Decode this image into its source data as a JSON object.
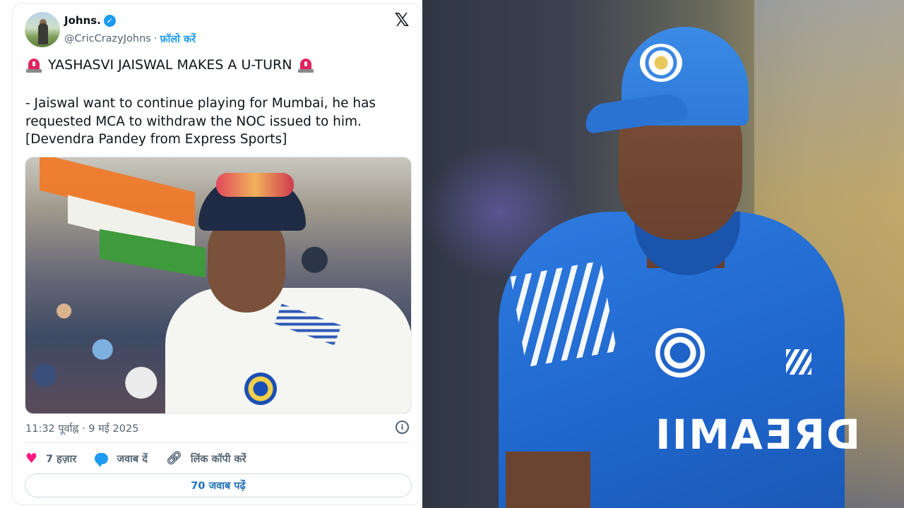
{
  "tweet": {
    "author": {
      "display_name": "Johns.",
      "handle": "@CricCrazyJohns",
      "separator": "·",
      "follow_label": "फ़ॉलो करें",
      "verified": true
    },
    "headline": "YASHASVI JAISWAL MAKES A U-TURN",
    "body": "- Jaiswal want to continue playing for Mumbai, he has requested MCA to withdraw the NOC issued to him.\n[Devendra Pandey from Express Sports]",
    "timestamp": "11:32 पूर्वाह्न · 9 मई 2025",
    "actions": {
      "likes": "7 हज़ार",
      "reply_label": "जवाब दें",
      "copy_link_label": "लिंक कॉपी करें"
    },
    "read_replies_label": "70 जवाब पढ़ें"
  },
  "right_photo": {
    "jersey_text": "IIMAƎЯᗡ"
  },
  "icons": {
    "x_logo": "x-logo-icon",
    "verified": "verified-badge-icon",
    "siren": "siren-icon",
    "info": "info-icon",
    "heart": "heart-icon",
    "reply": "reply-bubble-icon",
    "link": "link-icon"
  },
  "colors": {
    "accent": "#1d9bf0",
    "heart": "#f91880",
    "muted": "#536471"
  }
}
